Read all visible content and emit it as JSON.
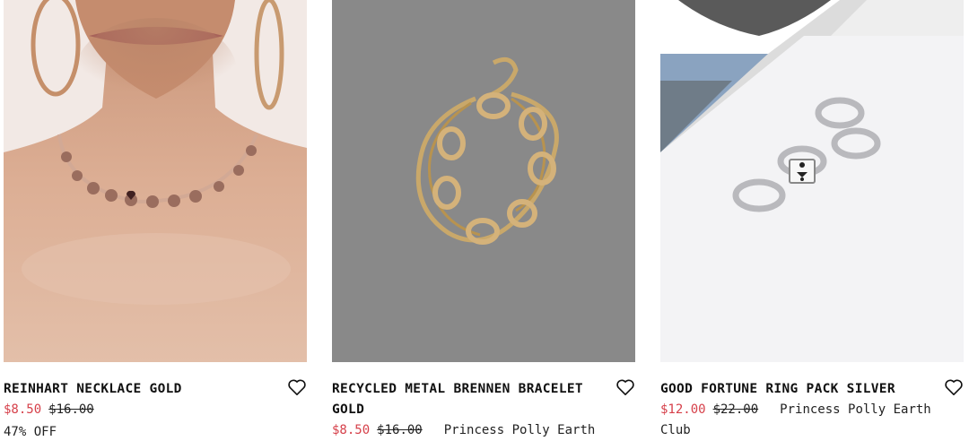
{
  "products": [
    {
      "title": "REINHART NECKLACE GOLD",
      "sale_price": "$8.50",
      "original_price": "$16.00",
      "badge": "47% OFF",
      "image_icon": "necklace-photo"
    },
    {
      "title_line1": "RECYCLED METAL BRENNEN BRACELET",
      "title_line2": "GOLD",
      "sale_price": "$8.50",
      "original_price": "$16.00",
      "tag": "Princess Polly Earth",
      "image_icon": "bracelet-photo"
    },
    {
      "title": "GOOD FORTUNE RING PACK SILVER",
      "sale_price": "$12.00",
      "original_price": "$22.00",
      "tag": "Princess Polly Earth",
      "tag_cont": "Club",
      "image_icon": "ring-pack-photo"
    }
  ],
  "colors": {
    "sale": "#d6404a",
    "text": "#111111"
  },
  "icons": {
    "wishlist": "heart-outline-icon"
  }
}
